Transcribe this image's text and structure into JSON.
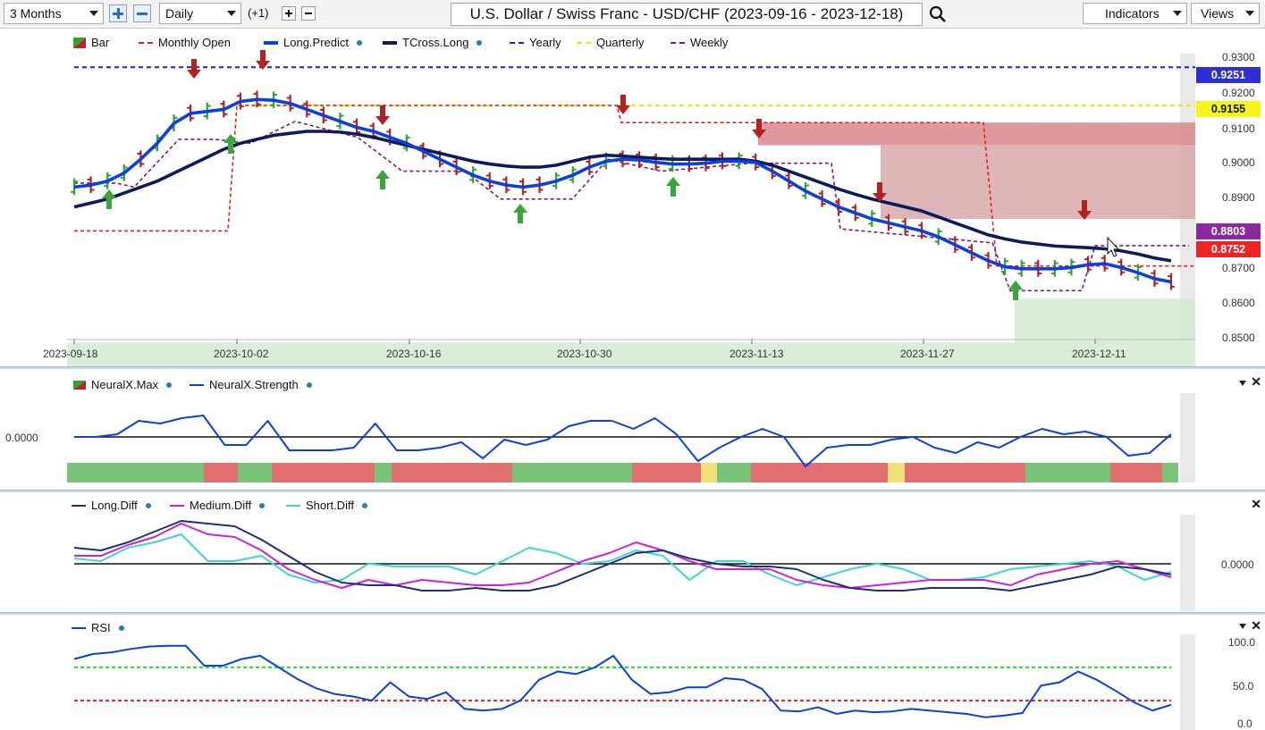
{
  "toolbar": {
    "period": "3 Months",
    "interval": "Daily",
    "offset": "(+1)",
    "title": "U.S. Dollar / Swiss Franc - USD/CHF (2023-09-16 - 2023-12-18)",
    "indicators": "Indicators",
    "views": "Views"
  },
  "legend": {
    "bar": "Bar",
    "monthly_open": "Monthly Open",
    "long_predict": "Long.Predict",
    "tcross_long": "TCross.Long",
    "yearly": "Yearly",
    "quarterly": "Quarterly",
    "weekly": "Weekly"
  },
  "price_axis": [
    "0.9300",
    "0.9200",
    "0.9100",
    "0.9000",
    "0.8900",
    "0.8700",
    "0.8600",
    "0.8500"
  ],
  "price_tags": {
    "yearly": "0.9251",
    "quarterly": "0.9155",
    "weekly": "0.8803",
    "monthly": "0.8752"
  },
  "date_axis": [
    "2023-09-18",
    "2023-10-02",
    "2023-10-16",
    "2023-10-30",
    "2023-11-13",
    "2023-11-27",
    "2023-12-11"
  ],
  "neural": {
    "legend_max": "NeuralX.Max",
    "legend_strength": "NeuralX.Strength",
    "zero_label": "0.0000"
  },
  "diff": {
    "legend_long": "Long.Diff",
    "legend_medium": "Medium.Diff",
    "legend_short": "Short.Diff",
    "zero_label": "0.0000"
  },
  "rsi": {
    "legend": "RSI",
    "ticks": [
      "100.0",
      "50.0",
      "0.0"
    ]
  },
  "colors": {
    "up": "#2fa52f",
    "down": "#b22222",
    "long_predict": "#0a3fe0",
    "tcross": "#0d1a5c",
    "yearly": "#2020c8",
    "quarterly": "#e8e800",
    "weekly": "#7a1a7a",
    "monthly": "#e02020"
  },
  "chart_data": [
    {
      "type": "line",
      "title": "U.S. Dollar / Swiss Franc - USD/CHF (2023-09-16 - 2023-12-18)",
      "x": [
        "09-15",
        "09-18",
        "09-19",
        "09-20",
        "09-21",
        "09-22",
        "09-25",
        "09-26",
        "09-27",
        "09-28",
        "09-29",
        "10-02",
        "10-03",
        "10-04",
        "10-05",
        "10-06",
        "10-09",
        "10-10",
        "10-11",
        "10-12",
        "10-13",
        "10-16",
        "10-17",
        "10-18",
        "10-19",
        "10-20",
        "10-23",
        "10-24",
        "10-25",
        "10-26",
        "10-27",
        "10-30",
        "10-31",
        "11-01",
        "11-02",
        "11-03",
        "11-06",
        "11-07",
        "11-08",
        "11-09",
        "11-10",
        "11-13",
        "11-14",
        "11-15",
        "11-16",
        "11-17",
        "11-20",
        "11-21",
        "11-22",
        "11-23",
        "11-24",
        "11-27",
        "11-28",
        "11-29",
        "11-30",
        "12-01",
        "12-04",
        "12-05",
        "12-06",
        "12-07",
        "12-08",
        "12-11",
        "12-12",
        "12-13",
        "12-14",
        "12-15",
        "12-18"
      ],
      "series": [
        {
          "name": "Long.Predict",
          "values": [
            0.895,
            0.8955,
            0.8965,
            0.8985,
            0.902,
            0.906,
            0.911,
            0.9135,
            0.914,
            0.9145,
            0.9165,
            0.917,
            0.9168,
            0.916,
            0.9145,
            0.913,
            0.9115,
            0.91,
            0.909,
            0.9075,
            0.906,
            0.904,
            0.902,
            0.9,
            0.898,
            0.8965,
            0.8955,
            0.895,
            0.8955,
            0.8965,
            0.898,
            0.9,
            0.9015,
            0.902,
            0.9018,
            0.9012,
            0.9008,
            0.9008,
            0.901,
            0.9015,
            0.9015,
            0.9012,
            0.899,
            0.8965,
            0.894,
            0.892,
            0.89,
            0.8885,
            0.887,
            0.886,
            0.885,
            0.884,
            0.8825,
            0.8805,
            0.8785,
            0.8765,
            0.875,
            0.8745,
            0.8745,
            0.8745,
            0.8748,
            0.8755,
            0.8758,
            0.8748,
            0.8735,
            0.872,
            0.8712
          ]
        },
        {
          "name": "TCross.Long",
          "values": [
            0.89,
            0.891,
            0.892,
            0.8935,
            0.895,
            0.8965,
            0.8985,
            0.9005,
            0.9025,
            0.9045,
            0.906,
            0.907,
            0.908,
            0.9085,
            0.909,
            0.909,
            0.9088,
            0.9083,
            0.9075,
            0.9065,
            0.9055,
            0.9045,
            0.9035,
            0.9025,
            0.9015,
            0.9008,
            0.9003,
            0.9,
            0.9,
            0.9005,
            0.9015,
            0.9025,
            0.903,
            0.9028,
            0.9025,
            0.9022,
            0.902,
            0.902,
            0.902,
            0.902,
            0.902,
            0.9015,
            0.9005,
            0.899,
            0.8975,
            0.896,
            0.8945,
            0.8932,
            0.892,
            0.891,
            0.89,
            0.889,
            0.8875,
            0.886,
            0.8845,
            0.883,
            0.882,
            0.8812,
            0.8807,
            0.8802,
            0.88,
            0.8798,
            0.8795,
            0.879,
            0.8782,
            0.8772,
            0.8765
          ]
        }
      ],
      "levels": {
        "Yearly": 0.9251,
        "Quarterly": 0.9155,
        "Weekly": 0.8803,
        "Monthly Open": 0.8752
      },
      "ylim": [
        0.85,
        0.933
      ],
      "xlabel": "",
      "ylabel": ""
    },
    {
      "type": "line",
      "series": [
        {
          "name": "NeuralX.Strength",
          "values": [
            0.0,
            0.0,
            0.1,
            0.6,
            0.5,
            0.7,
            0.8,
            -0.3,
            -0.3,
            0.6,
            -0.5,
            -0.5,
            -0.5,
            -0.4,
            0.5,
            -0.5,
            -0.5,
            -0.4,
            -0.2,
            -0.8,
            -0.1,
            -0.3,
            -0.1,
            0.4,
            0.6,
            0.6,
            0.3,
            0.7,
            0.1,
            -0.9,
            -0.4,
            0.0,
            0.3,
            0.0,
            -1.1,
            -0.4,
            -0.3,
            -0.3,
            -0.1,
            0.0,
            -0.4,
            -0.6,
            -0.2,
            -0.4,
            0.0,
            0.3,
            0.1,
            0.2,
            0.0,
            -0.7,
            -0.6,
            0.1
          ]
        }
      ],
      "ylim": [
        -1.5,
        1.5
      ]
    },
    {
      "type": "line",
      "series": [
        {
          "name": "Long.Diff",
          "values": [
            0.6,
            0.5,
            0.8,
            1.2,
            1.6,
            1.5,
            1.4,
            0.9,
            0.3,
            -0.3,
            -0.7,
            -0.8,
            -0.8,
            -1.0,
            -1.0,
            -0.9,
            -1.0,
            -1.0,
            -0.8,
            -0.4,
            0.0,
            0.4,
            0.5,
            0.2,
            0.0,
            -0.1,
            -0.1,
            -0.2,
            -0.6,
            -0.9,
            -1.0,
            -1.0,
            -0.9,
            -0.9,
            -0.9,
            -1.0,
            -0.8,
            -0.6,
            -0.4,
            -0.1,
            -0.2,
            -0.4
          ]
        },
        {
          "name": "Medium.Diff",
          "values": [
            0.3,
            0.3,
            0.7,
            1.0,
            1.5,
            1.1,
            1.0,
            0.5,
            -0.2,
            -0.6,
            -0.9,
            -0.6,
            -0.8,
            -0.6,
            -0.7,
            -0.8,
            -0.8,
            -0.7,
            -0.3,
            0.1,
            0.4,
            0.8,
            0.5,
            0.1,
            -0.2,
            -0.2,
            -0.2,
            -0.6,
            -0.8,
            -0.9,
            -0.8,
            -0.7,
            -0.6,
            -0.6,
            -0.6,
            -0.8,
            -0.4,
            -0.2,
            0.0,
            0.1,
            -0.2,
            -0.5
          ]
        },
        {
          "name": "Short.Diff",
          "values": [
            0.2,
            0.1,
            0.6,
            0.8,
            1.1,
            0.1,
            0.1,
            0.3,
            -0.4,
            -0.7,
            -0.6,
            0.0,
            -0.1,
            -0.1,
            -0.1,
            -0.4,
            0.1,
            0.6,
            0.4,
            0.0,
            0.1,
            0.5,
            0.3,
            -0.6,
            0.1,
            0.1,
            -0.4,
            -0.8,
            -0.5,
            -0.2,
            0.0,
            -0.2,
            -0.6,
            -0.6,
            -0.5,
            -0.2,
            -0.1,
            0.0,
            0.1,
            -0.1,
            -0.6,
            -0.3
          ]
        }
      ],
      "ylim": [
        -2,
        2
      ]
    },
    {
      "type": "line",
      "series": [
        {
          "name": "RSI",
          "values": [
            80,
            86,
            88,
            92,
            95,
            96,
            96,
            72,
            72,
            80,
            84,
            70,
            56,
            45,
            38,
            35,
            30,
            52,
            35,
            32,
            40,
            20,
            18,
            20,
            30,
            55,
            65,
            62,
            70,
            84,
            55,
            38,
            40,
            46,
            46,
            57,
            55,
            44,
            18,
            17,
            22,
            14,
            18,
            16,
            17,
            20,
            18,
            16,
            14,
            10,
            12,
            15,
            48,
            52,
            65,
            55,
            42,
            28,
            18,
            25
          ]
        }
      ],
      "levels": {
        "upper": 70,
        "lower": 30
      },
      "ylim": [
        0,
        100
      ]
    }
  ]
}
